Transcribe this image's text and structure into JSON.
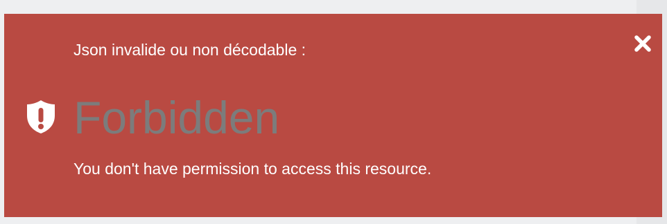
{
  "alert": {
    "heading": "Json invalide ou non décodable :",
    "close_icon": "close-icon",
    "status_icon": "shield-exclamation-icon",
    "title": "Forbidden",
    "message": "You don't have permission to access this resource.",
    "colors": {
      "background": "#b94a42",
      "title": "#7c7c7c",
      "text": "#ffffff",
      "page": "#eeeff1"
    }
  }
}
